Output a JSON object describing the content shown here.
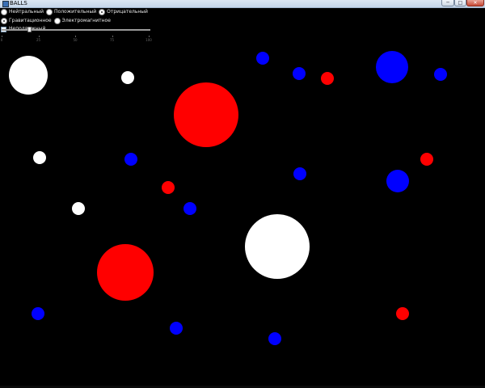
{
  "window": {
    "title": "BALLS",
    "buttons": {
      "minimize": "─",
      "maximize": "□",
      "close": "✕"
    }
  },
  "charge": {
    "options": [
      {
        "label": "Нейтральный",
        "checked": false
      },
      {
        "label": "Положительный",
        "checked": false
      },
      {
        "label": "Отрицательный",
        "checked": true
      }
    ]
  },
  "force": {
    "options": [
      {
        "label": "Гравитационное",
        "checked": true
      },
      {
        "label": "Электромагнитное",
        "checked": false
      }
    ]
  },
  "fixed": {
    "label": "Неподвижный",
    "checked": false
  },
  "slider": {
    "min": 0,
    "max": 100,
    "value": 18,
    "tick_labels": [
      "0",
      "25",
      "50",
      "75",
      "100"
    ]
  },
  "colors": {
    "neutral": "#ffffff",
    "positive": "#ff0000",
    "negative": "#0000ff",
    "background": "#000000"
  },
  "balls": [
    {
      "charge": "neutral"
    },
    {
      "charge": "neutral"
    },
    {
      "charge": "neutral"
    },
    {
      "charge": "neutral"
    },
    {
      "charge": "neutral"
    },
    {
      "charge": "positive"
    },
    {
      "charge": "positive"
    },
    {
      "charge": "positive"
    },
    {
      "charge": "positive"
    },
    {
      "charge": "positive"
    },
    {
      "charge": "positive"
    },
    {
      "charge": "negative"
    },
    {
      "charge": "negative"
    },
    {
      "charge": "negative"
    },
    {
      "charge": "negative"
    },
    {
      "charge": "negative"
    },
    {
      "charge": "negative"
    },
    {
      "charge": "negative"
    },
    {
      "charge": "negative"
    },
    {
      "charge": "negative"
    },
    {
      "charge": "negative"
    },
    {
      "charge": "negative"
    }
  ]
}
